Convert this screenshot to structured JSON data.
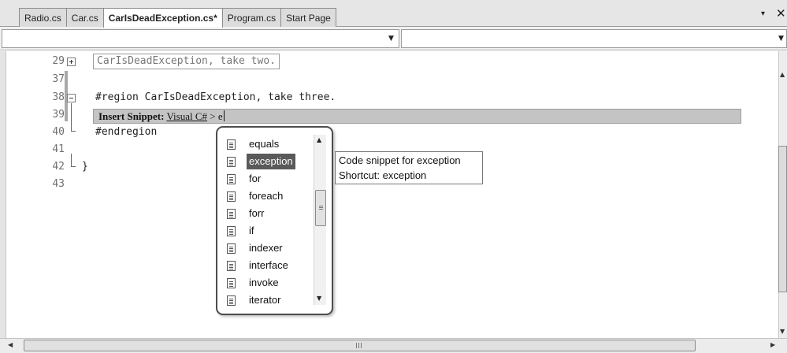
{
  "tabs": [
    {
      "label": "Radio.cs",
      "active": false
    },
    {
      "label": "Car.cs",
      "active": false
    },
    {
      "label": "CarIsDeadException.cs*",
      "active": true
    },
    {
      "label": "Program.cs",
      "active": false
    },
    {
      "label": "Start Page",
      "active": false
    }
  ],
  "tabstrip": {
    "menu_icon": "▾",
    "close_icon": "✕"
  },
  "dropdowns": {
    "type_selector_value": "",
    "member_selector_value": ""
  },
  "editor": {
    "lines": [
      {
        "number": "29",
        "text": "CarIsDeadException, take two."
      },
      {
        "number": "37",
        "text": ""
      },
      {
        "number": "38",
        "text": "#region CarIsDeadException, take three."
      },
      {
        "number": "39",
        "text": ""
      },
      {
        "number": "40",
        "text": "#endregion"
      },
      {
        "number": "41",
        "text": ""
      },
      {
        "number": "42",
        "text": "}"
      },
      {
        "number": "43",
        "text": ""
      }
    ]
  },
  "snippet_bar": {
    "label": "Insert Snippet:",
    "path_link": "Visual C#",
    "separator": ">",
    "typed": "e"
  },
  "completion": {
    "items": [
      {
        "label": "equals",
        "selected": false
      },
      {
        "label": "exception",
        "selected": true
      },
      {
        "label": "for",
        "selected": false
      },
      {
        "label": "foreach",
        "selected": false
      },
      {
        "label": "forr",
        "selected": false
      },
      {
        "label": "if",
        "selected": false
      },
      {
        "label": "indexer",
        "selected": false
      },
      {
        "label": "interface",
        "selected": false
      },
      {
        "label": "invoke",
        "selected": false
      },
      {
        "label": "iterator",
        "selected": false
      }
    ],
    "icon": "snippet-icon"
  },
  "tooltip": {
    "line1": "Code snippet for exception",
    "line2": "Shortcut: exception"
  },
  "hscroll_grip": "III"
}
